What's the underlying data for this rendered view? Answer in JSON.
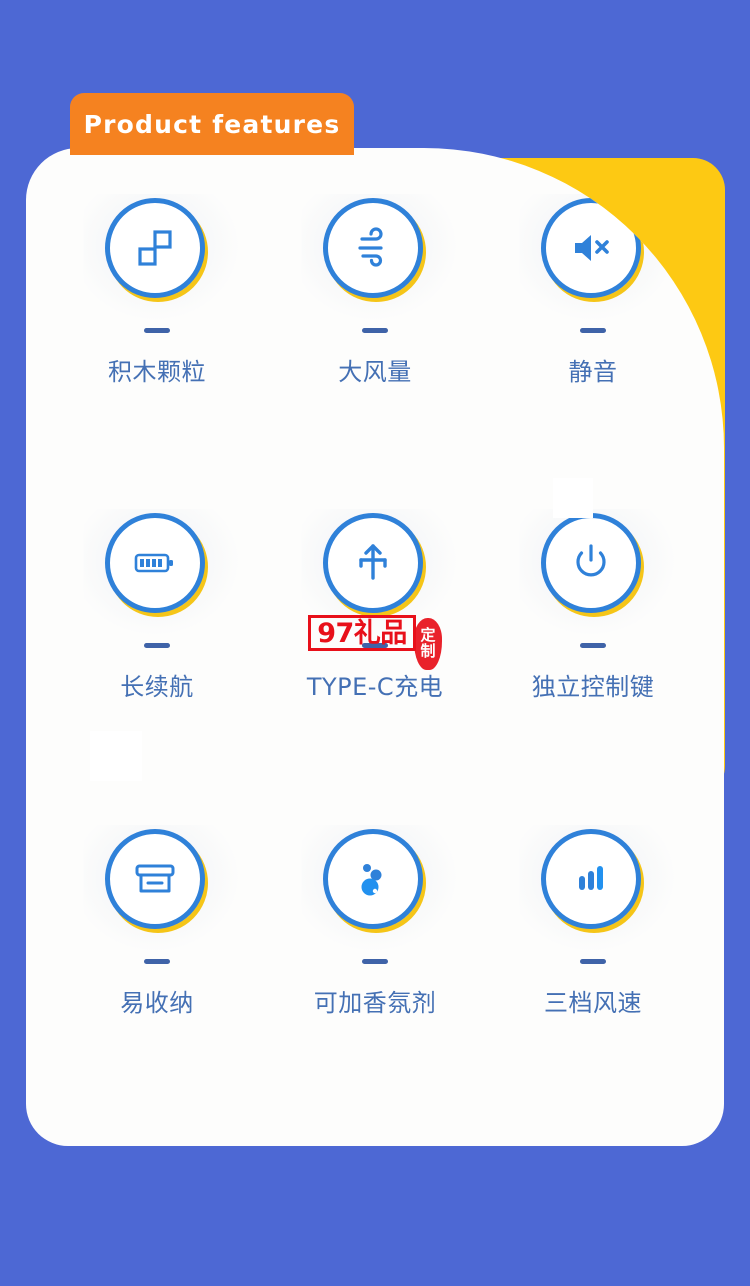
{
  "page": {
    "background_color": "#4d68d4",
    "card_color": "#fdfdfc",
    "accent_yellow": "#fdc913",
    "accent_orange": "#f58220",
    "accent_blue": "#2f81d9",
    "label_color": "#4470b4"
  },
  "header": {
    "tab_label": "Product  features"
  },
  "features": [
    {
      "icon": "blocks-icon",
      "label": "积木颗粒"
    },
    {
      "icon": "wind-icon",
      "label": "大风量"
    },
    {
      "icon": "mute-speaker-icon",
      "label": "静音"
    },
    {
      "icon": "battery-icon",
      "label": "长续航"
    },
    {
      "icon": "usb-c-charge-icon",
      "label": "TYPE-C充电"
    },
    {
      "icon": "power-button-icon",
      "label": "独立控制键"
    },
    {
      "icon": "storage-box-icon",
      "label": "易收纳"
    },
    {
      "icon": "fragrance-drops-icon",
      "label": "可加香氛剂"
    },
    {
      "icon": "three-bars-icon",
      "label": "三档风速"
    }
  ],
  "watermark": {
    "box_text": "97礼品",
    "stamp_line1": "定",
    "stamp_line2": "制",
    "color": "#e8101a"
  }
}
